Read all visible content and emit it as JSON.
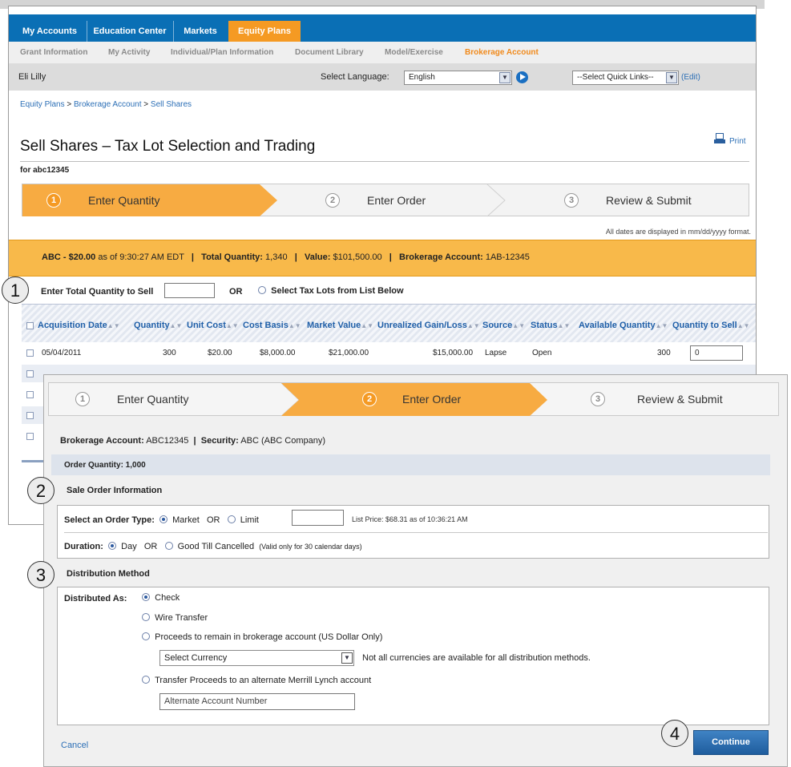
{
  "nav": {
    "tabs": [
      {
        "label": "My Accounts"
      },
      {
        "label": "Education Center"
      },
      {
        "label": "Markets"
      },
      {
        "label": "Equity Plans"
      }
    ]
  },
  "subnav": {
    "items": [
      {
        "label": "Grant Information"
      },
      {
        "label": "My Activity"
      },
      {
        "label": "Individual/Plan Information"
      },
      {
        "label": "Document Library"
      },
      {
        "label": "Model/Exercise"
      },
      {
        "label": "Brokerage Account"
      }
    ]
  },
  "header": {
    "company": "Eli Lilly",
    "language_label": "Select Language:",
    "language_value": "English",
    "quick_links_value": "--Select Quick Links--",
    "edit_link": "(Edit)"
  },
  "breadcrumb": {
    "items": [
      "Equity Plans",
      "Brokerage Account",
      "Sell Shares"
    ],
    "separator": ">"
  },
  "page": {
    "title": "Sell Shares – Tax Lot Selection and Trading",
    "print_label": "Print",
    "for_account": "for abc12345",
    "date_note": "All dates are displayed in mm/dd/yyyy format."
  },
  "steps": [
    {
      "num": "1",
      "label": "Enter Quantity"
    },
    {
      "num": "2",
      "label": "Enter Order"
    },
    {
      "num": "3",
      "label": "Review & Submit"
    }
  ],
  "summary": {
    "security": "ABC - $20.00",
    "as_of": "as of 9:30:27 AM EDT",
    "total_quantity_label": "Total Quantity:",
    "total_quantity": "1,340",
    "value_label": "Value:",
    "value": "$101,500.00",
    "brokerage_label": "Brokerage Account:",
    "brokerage": "1AB-12345",
    "divider": "|"
  },
  "quantity_entry": {
    "label": "Enter Total Quantity to Sell",
    "or_label": "OR",
    "tax_lot_label": "Select Tax Lots from List Below"
  },
  "table": {
    "columns": [
      "Acquisition Date",
      "Quantity",
      "Unit Cost",
      "Cost Basis",
      "Market Value",
      "Unrealized Gain/Loss",
      "Source",
      "Status",
      "Available Quantity",
      "Quantity to Sell"
    ],
    "rows": [
      {
        "date": "05/04/2011",
        "quantity": "300",
        "unit_cost": "$20.00",
        "cost_basis": "$8,000.00",
        "market_value": "$21,000.00",
        "gain": "$15,000.00",
        "source": "Lapse",
        "status": "Open",
        "available": "300",
        "to_sell": "0"
      }
    ]
  },
  "callouts": [
    "1",
    "2",
    "3",
    "4"
  ],
  "order": {
    "brokerage_label": "Brokerage Account:",
    "brokerage_value": "ABC12345",
    "security_label": "Security:",
    "security_value": "ABC (ABC Company)",
    "divider": "|",
    "order_quantity": "Order Quantity: 1,000",
    "sale_section": "Sale Order Information",
    "order_type_label": "Select an Order Type:",
    "market_label": "Market",
    "or_label": "OR",
    "limit_label": "Limit",
    "list_price": "List Price: $68.31 as of 10:36:21 AM",
    "duration_label": "Duration:",
    "day_label": "Day",
    "gtc_label": "Good Till Cancelled",
    "gtc_note": "(Valid only for 30 calendar days)",
    "distribution_section": "Distribution Method",
    "distributed_as_label": "Distributed As:",
    "options": [
      "Check",
      "Wire Transfer",
      "Proceeds to remain in brokerage account (US Dollar Only)",
      "Transfer Proceeds to an alternate Merrill Lynch account"
    ],
    "currency_select": "Select Currency",
    "currency_note": "Not all currencies are available for all distribution methods.",
    "alt_account_placeholder": "Alternate Account Number",
    "cancel_label": "Cancel",
    "continue_label": "Continue"
  },
  "colors": {
    "nav_blue": "#0a6fb5",
    "accent_orange": "#f59a23",
    "summary_orange": "#f8b94a",
    "link_blue": "#2c6fb6"
  }
}
